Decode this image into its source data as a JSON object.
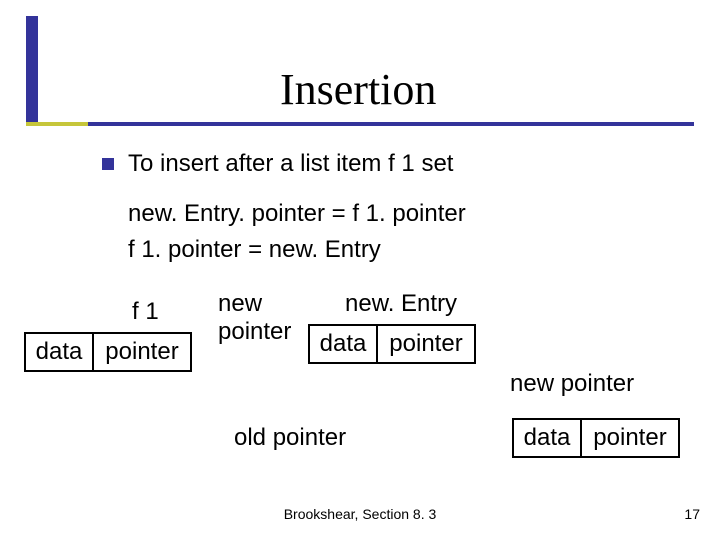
{
  "title": "Insertion",
  "bullet": "To insert after a list item f 1 set",
  "code1": "new. Entry. pointer = f 1. pointer",
  "code2": "f 1. pointer = new. Entry",
  "labels": {
    "f1": "f 1",
    "newPointer": "new\npointer",
    "newEntry": "new. Entry",
    "newPointerRight": "new pointer",
    "oldPointer": "old pointer"
  },
  "node": {
    "data": "data",
    "pointer": "pointer"
  },
  "footer": "Brookshear, Section 8. 3",
  "pageNumber": "17"
}
